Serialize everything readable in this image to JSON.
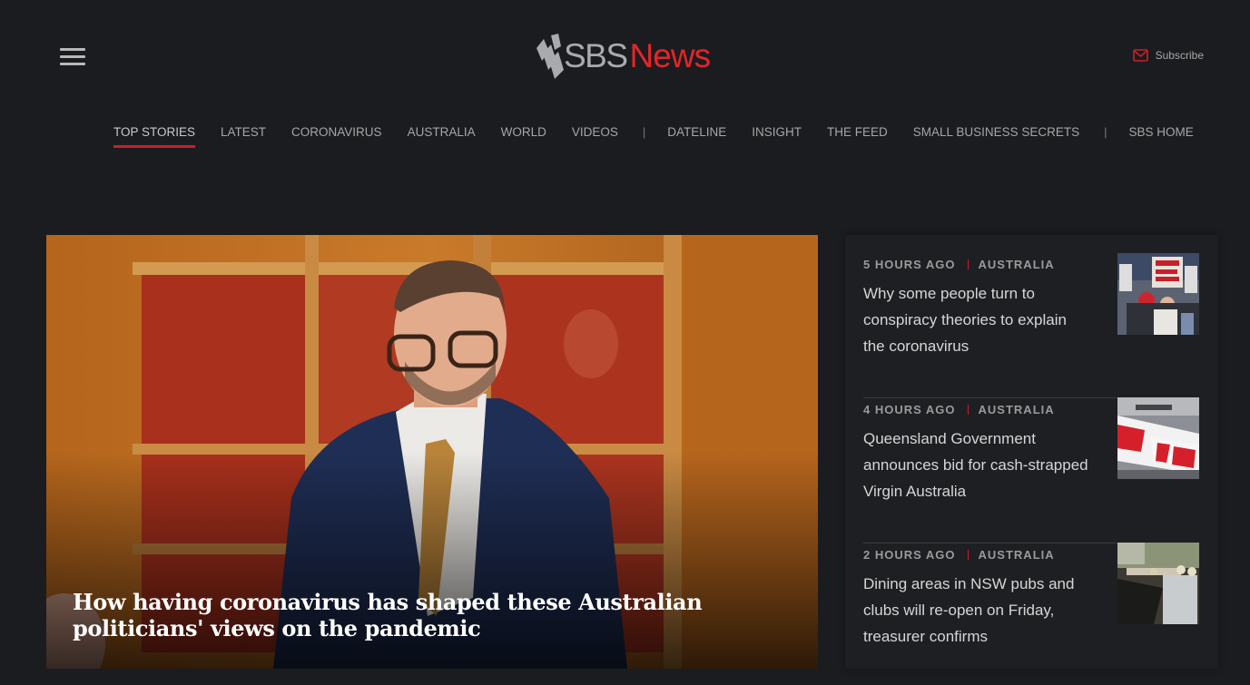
{
  "header": {
    "logo_sbs": "SBS",
    "logo_news": "News",
    "subscribe_label": "Subscribe"
  },
  "nav": {
    "items": [
      {
        "label": "TOP STORIES",
        "active": true
      },
      {
        "label": "LATEST"
      },
      {
        "label": "CORONAVIRUS"
      },
      {
        "label": "AUSTRALIA"
      },
      {
        "label": "WORLD"
      },
      {
        "label": "VIDEOS"
      },
      {
        "label": "DATELINE"
      },
      {
        "label": "INSIGHT"
      },
      {
        "label": "THE FEED"
      },
      {
        "label": "SMALL BUSINESS SECRETS"
      },
      {
        "label": "SBS HOME"
      }
    ],
    "separator": "|"
  },
  "hero": {
    "title": "How having coronavirus has shaped these Australian politicians' views on the pandemic"
  },
  "stories": [
    {
      "time": "5 HOURS AGO",
      "category": "AUSTRALIA",
      "title": "Why some people turn to conspiracy theories to explain the coronavirus",
      "thumb_icon": "protest-thumbnail"
    },
    {
      "time": "4 HOURS AGO",
      "category": "AUSTRALIA",
      "title": "Queensland Government announces bid for cash-strapped Virgin Australia",
      "thumb_icon": "aircraft-thumbnail"
    },
    {
      "time": "2 HOURS AGO",
      "category": "AUSTRALIA",
      "title": "Dining areas in NSW pubs and clubs will re-open on Friday, treasurer confirms",
      "thumb_icon": "dining-area-thumbnail"
    }
  ],
  "colors": {
    "background": "#1b1c1f",
    "accent": "#c8202a",
    "brand_red": "#e2262b"
  }
}
